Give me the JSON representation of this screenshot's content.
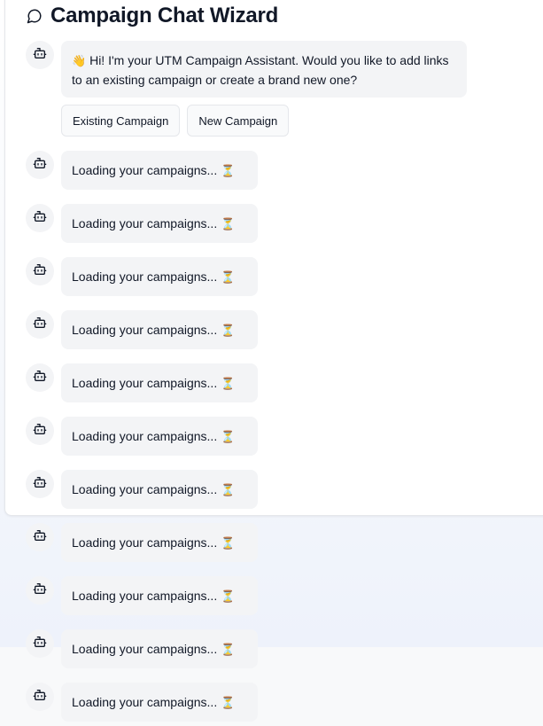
{
  "header": {
    "title": "Campaign Chat Wizard",
    "icon": "chat-bubble-icon"
  },
  "welcome": {
    "emoji": "👋",
    "text": "Hi! I'm your UTM Campaign Assistant. Would you like to add links to an existing campaign or create a brand new one?"
  },
  "choices": {
    "existing_label": "Existing Campaign",
    "new_label": "New Campaign"
  },
  "loading": {
    "text": "Loading your campaigns...",
    "emoji": "⏳",
    "count": 11
  },
  "avatar_icon": "bot-icon"
}
